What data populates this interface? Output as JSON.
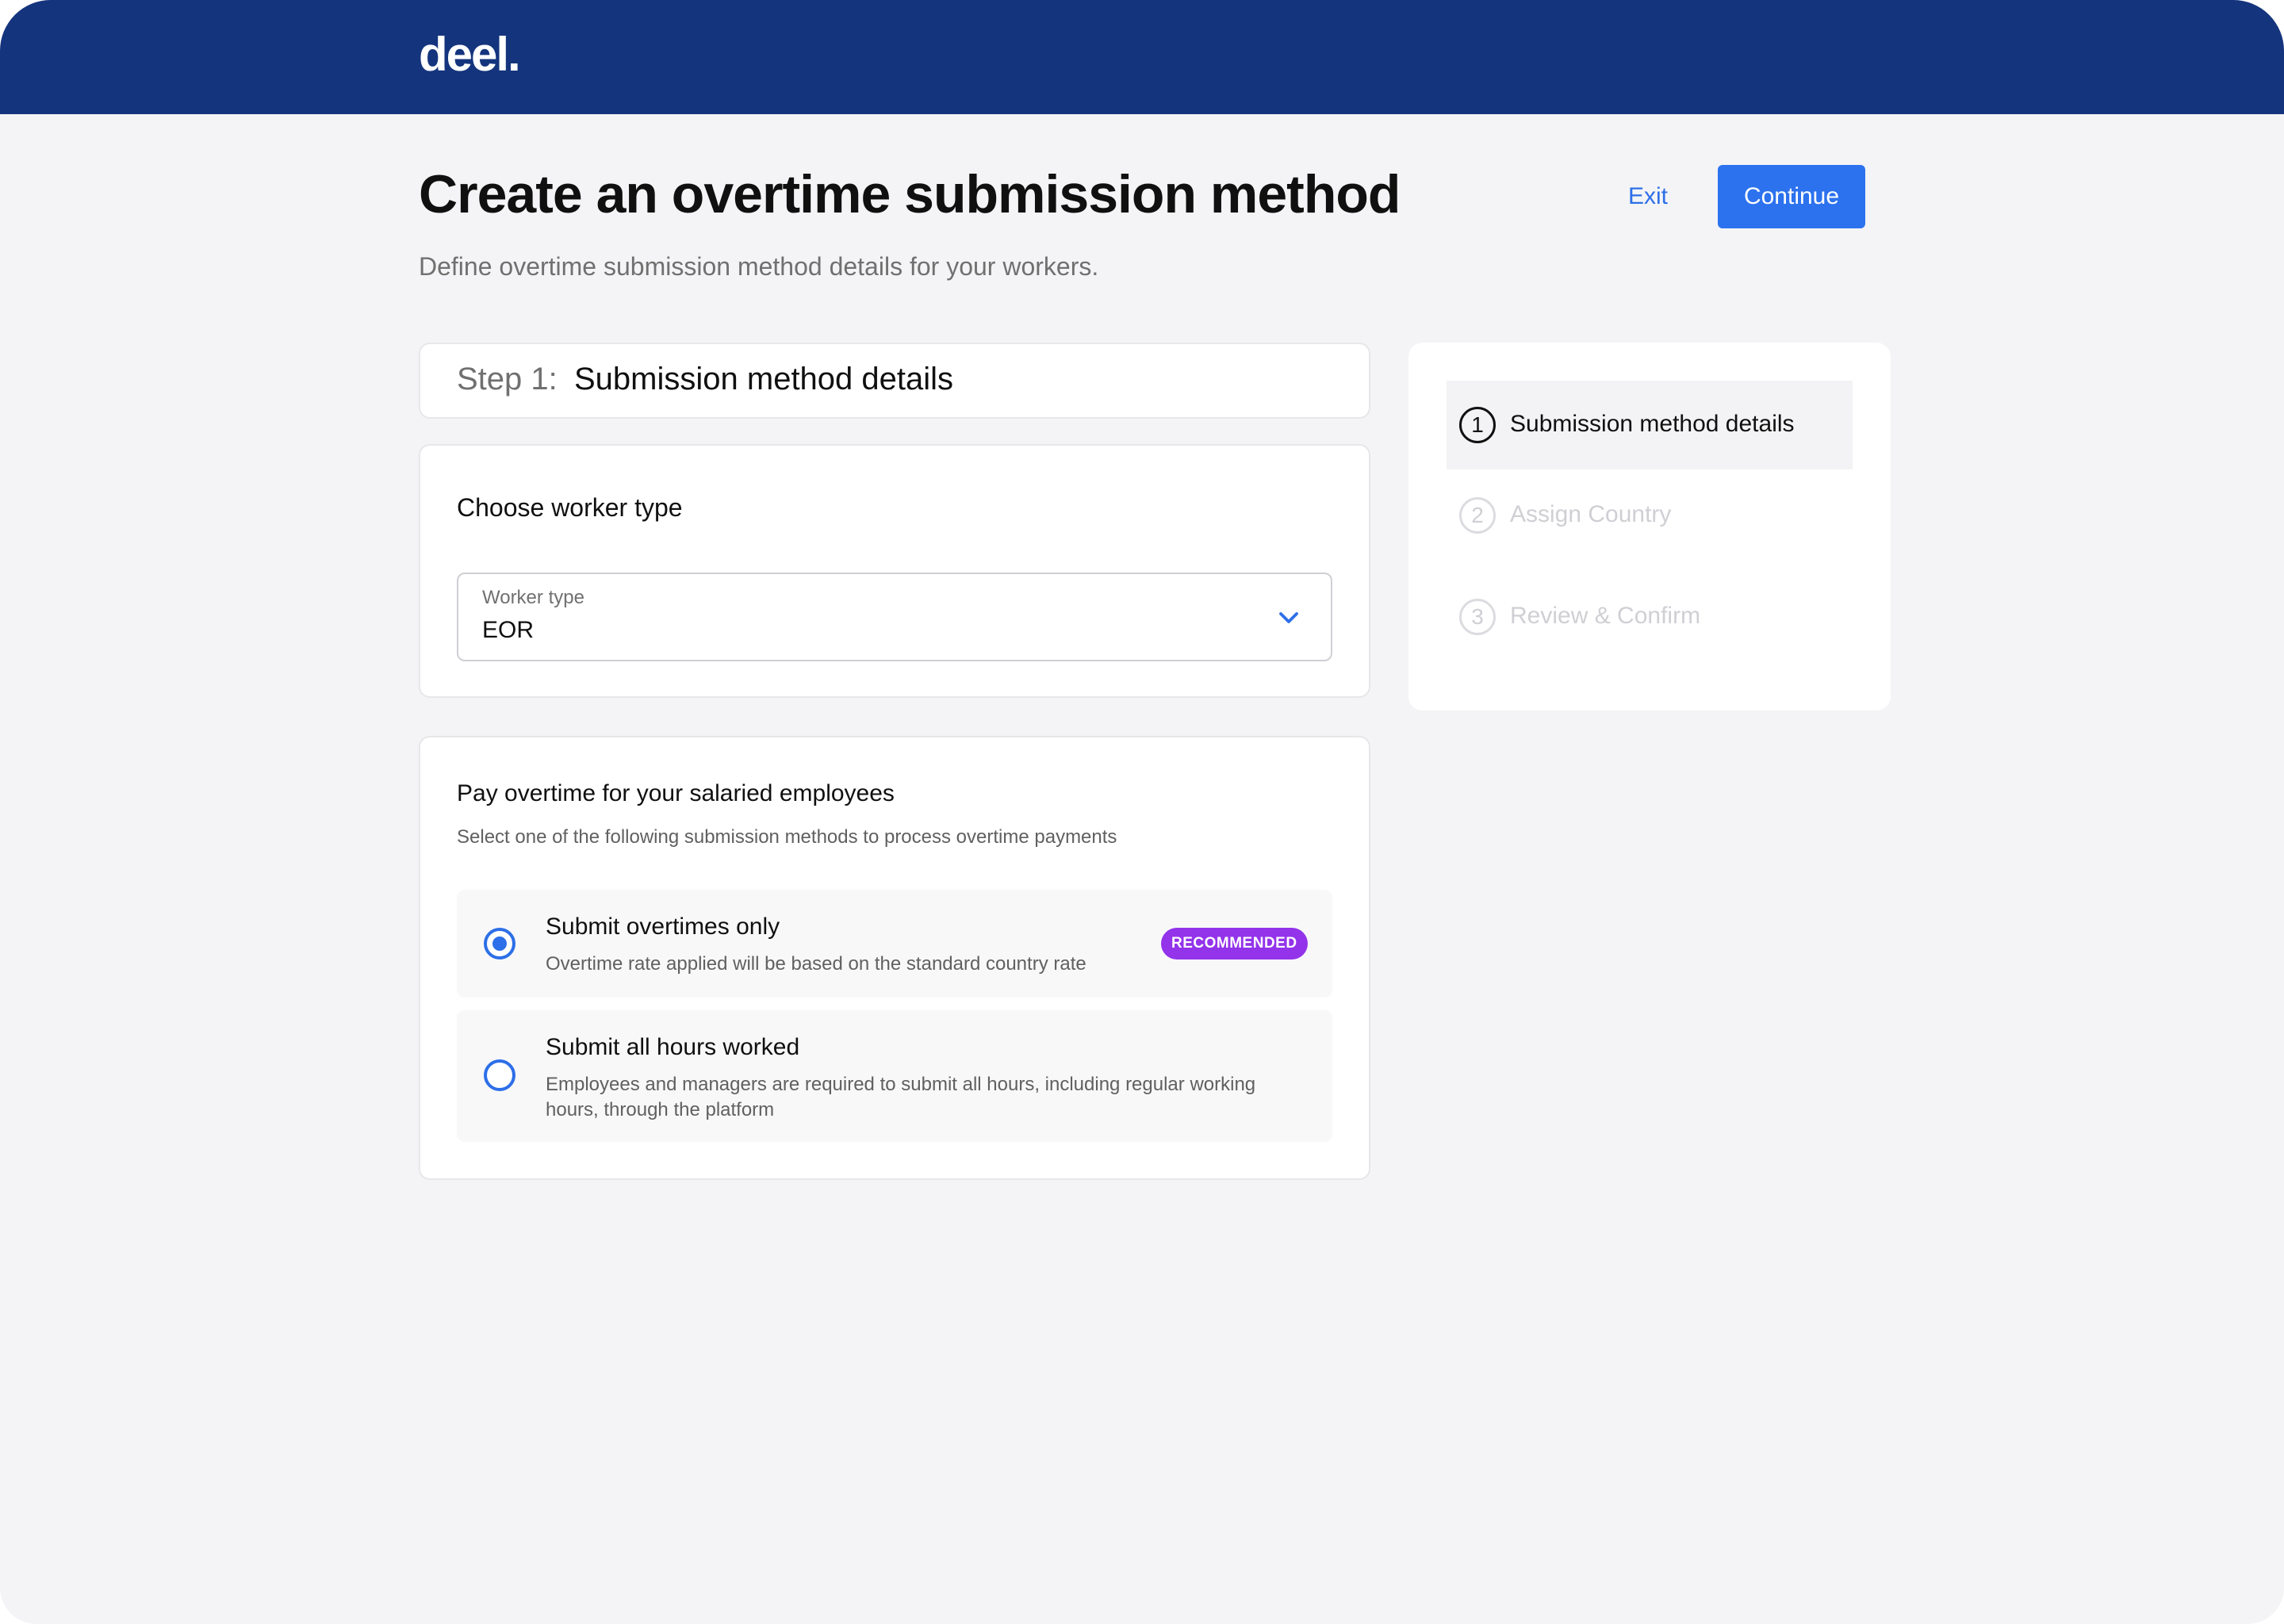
{
  "brand": {
    "logo": "deel."
  },
  "header": {
    "title": "Create an overtime submission method",
    "subtitle": "Define overtime submission method details for your workers.",
    "exit_label": "Exit",
    "continue_label": "Continue"
  },
  "step": {
    "prefix": "Step 1:",
    "title": "Submission method details"
  },
  "worker_type": {
    "section_title": "Choose worker type",
    "field_label": "Worker type",
    "value": "EOR"
  },
  "overtime": {
    "title": "Pay overtime for your salaried employees",
    "description": "Select one of the following submission methods to process overtime payments",
    "options": [
      {
        "title": "Submit overtimes only",
        "description": "Overtime rate applied will be based on the standard country rate",
        "badge": "RECOMMENDED",
        "selected": true
      },
      {
        "title": "Submit all hours worked",
        "description": "Employees and managers are required to submit all hours, including regular working hours, through the platform",
        "selected": false
      }
    ]
  },
  "stepper": {
    "items": [
      {
        "number": "1",
        "label": "Submission method details",
        "state": "active"
      },
      {
        "number": "2",
        "label": "Assign Country",
        "state": "inactive"
      },
      {
        "number": "3",
        "label": "Review & Confirm",
        "state": "inactive"
      }
    ]
  },
  "colors": {
    "header_bg": "#14347d",
    "primary": "#2c72ee",
    "badge": "#9333ea",
    "page_bg": "#f4f4f6"
  },
  "icons": {
    "select_chevron": "chevron-down-icon"
  }
}
